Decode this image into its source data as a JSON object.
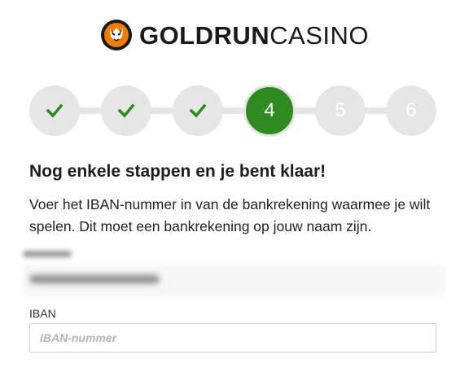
{
  "brand": {
    "name_bold": "GOLDRUN",
    "name_light": "CASINO",
    "logo_icon": "tiger-head-icon",
    "accent_color": "#f07d00"
  },
  "stepper": {
    "steps": [
      {
        "label": "",
        "state": "done",
        "icon": "checkmark-icon"
      },
      {
        "label": "",
        "state": "done",
        "icon": "checkmark-icon"
      },
      {
        "label": "",
        "state": "done",
        "icon": "checkmark-icon"
      },
      {
        "label": "4",
        "state": "current"
      },
      {
        "label": "5",
        "state": "upcoming"
      },
      {
        "label": "6",
        "state": "upcoming"
      }
    ],
    "done_color": "#2f8a1f",
    "current_color": "#2f8a1f",
    "inactive_color": "#e6e6e6"
  },
  "content": {
    "heading": "Nog enkele stappen en je bent klaar!",
    "description": "Voer het IBAN-nummer in van de bankrekening waarmee je wilt spelen. Dit moet een bankrekening op jouw naam zijn."
  },
  "form": {
    "iban_label": "IBAN",
    "iban_placeholder": "IBAN-nummer",
    "iban_value": ""
  }
}
